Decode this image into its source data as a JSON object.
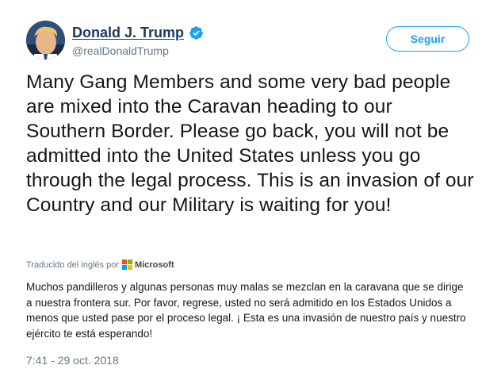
{
  "user": {
    "name": "Donald J. Trump",
    "screen_name": "@realDonaldTrump",
    "verified": true
  },
  "follow_button": {
    "label": "Seguir"
  },
  "tweet": {
    "text": "Many Gang Members and some very bad people are mixed into the Caravan heading to our Southern Border. Please go back, you will not be admitted into the United States unless you go through the legal process. This is an invasion of our Country and our Military is waiting for you!"
  },
  "translation": {
    "label": "Traducido del inglés por",
    "provider": "Microsoft",
    "text": "Muchos pandilleros y algunas personas muy malas se mezclan en la caravana que se dirige a nuestra frontera sur. Por favor, regrese, usted no será admitido en los Estados Unidos a menos que usted pase por el proceso legal. ¡ Esta es una invasión de nuestro país y nuestro ejército te está esperando!"
  },
  "timestamp": "7:41 - 29 oct. 2018",
  "colors": {
    "accent": "#1da1f2",
    "name": "#1b3a63",
    "secondary": "#657786",
    "text": "#14171a"
  },
  "icons": {
    "verified": "verified-badge-icon",
    "translator_logo": "microsoft-logo-icon"
  }
}
